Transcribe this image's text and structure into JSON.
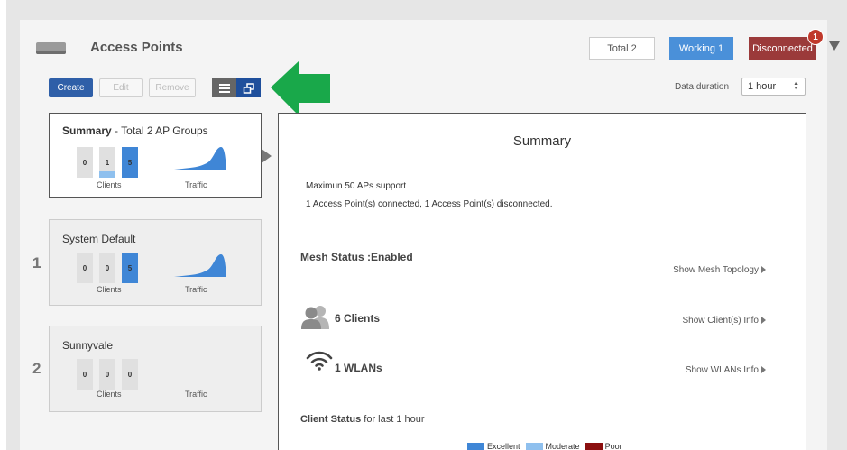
{
  "header": {
    "title": "Access Points",
    "total_label": "Total 2",
    "working_label": "Working 1",
    "disconnected_label": "Disconnected",
    "alert_count": "1"
  },
  "toolbar": {
    "create_label": "Create",
    "edit_label": "Edit",
    "remove_label": "Remove",
    "data_duration_label": "Data duration",
    "data_duration_value": "1 hour"
  },
  "cards": [
    {
      "title_bold": "Summary",
      "title_rest": " - Total 2 AP Groups",
      "number": "",
      "boxes": [
        "0",
        "1",
        "5"
      ],
      "clients_label": "Clients",
      "traffic_label": "Traffic"
    },
    {
      "title_bold": "",
      "title_rest": "System Default",
      "number": "1",
      "boxes": [
        "0",
        "0",
        "5"
      ],
      "clients_label": "Clients",
      "traffic_label": "Traffic"
    },
    {
      "title_bold": "",
      "title_rest": "Sunnyvale",
      "number": "2",
      "boxes": [
        "0",
        "0",
        "0"
      ],
      "clients_label": "Clients",
      "traffic_label": "Traffic"
    }
  ],
  "summary": {
    "title": "Summary",
    "max_text": "Maximun 50 APs support",
    "connected_text": "1 Access Point(s) connected, 1 Access Point(s) disconnected.",
    "mesh_status": "Mesh Status :Enabled",
    "mesh_link": "Show Mesh Topology",
    "clients_text": "6 Clients",
    "clients_link": "Show Client(s) Info",
    "wlans_text": "1 WLANs",
    "wlans_link": "Show WLANs Info",
    "client_status_bold": "Client Status",
    "client_status_rest": " for last 1 hour",
    "legend": [
      {
        "label": "Excellent",
        "color": "#3f86d6"
      },
      {
        "label": "Moderate",
        "color": "#8fc0ee"
      },
      {
        "label": "Poor",
        "color": "#8b0f0f"
      }
    ]
  },
  "colors": {
    "working": "#4a90d9",
    "disconnected": "#9b3a3a",
    "create": "#2f5fa8",
    "annotation_arrow": "#19a84a"
  }
}
